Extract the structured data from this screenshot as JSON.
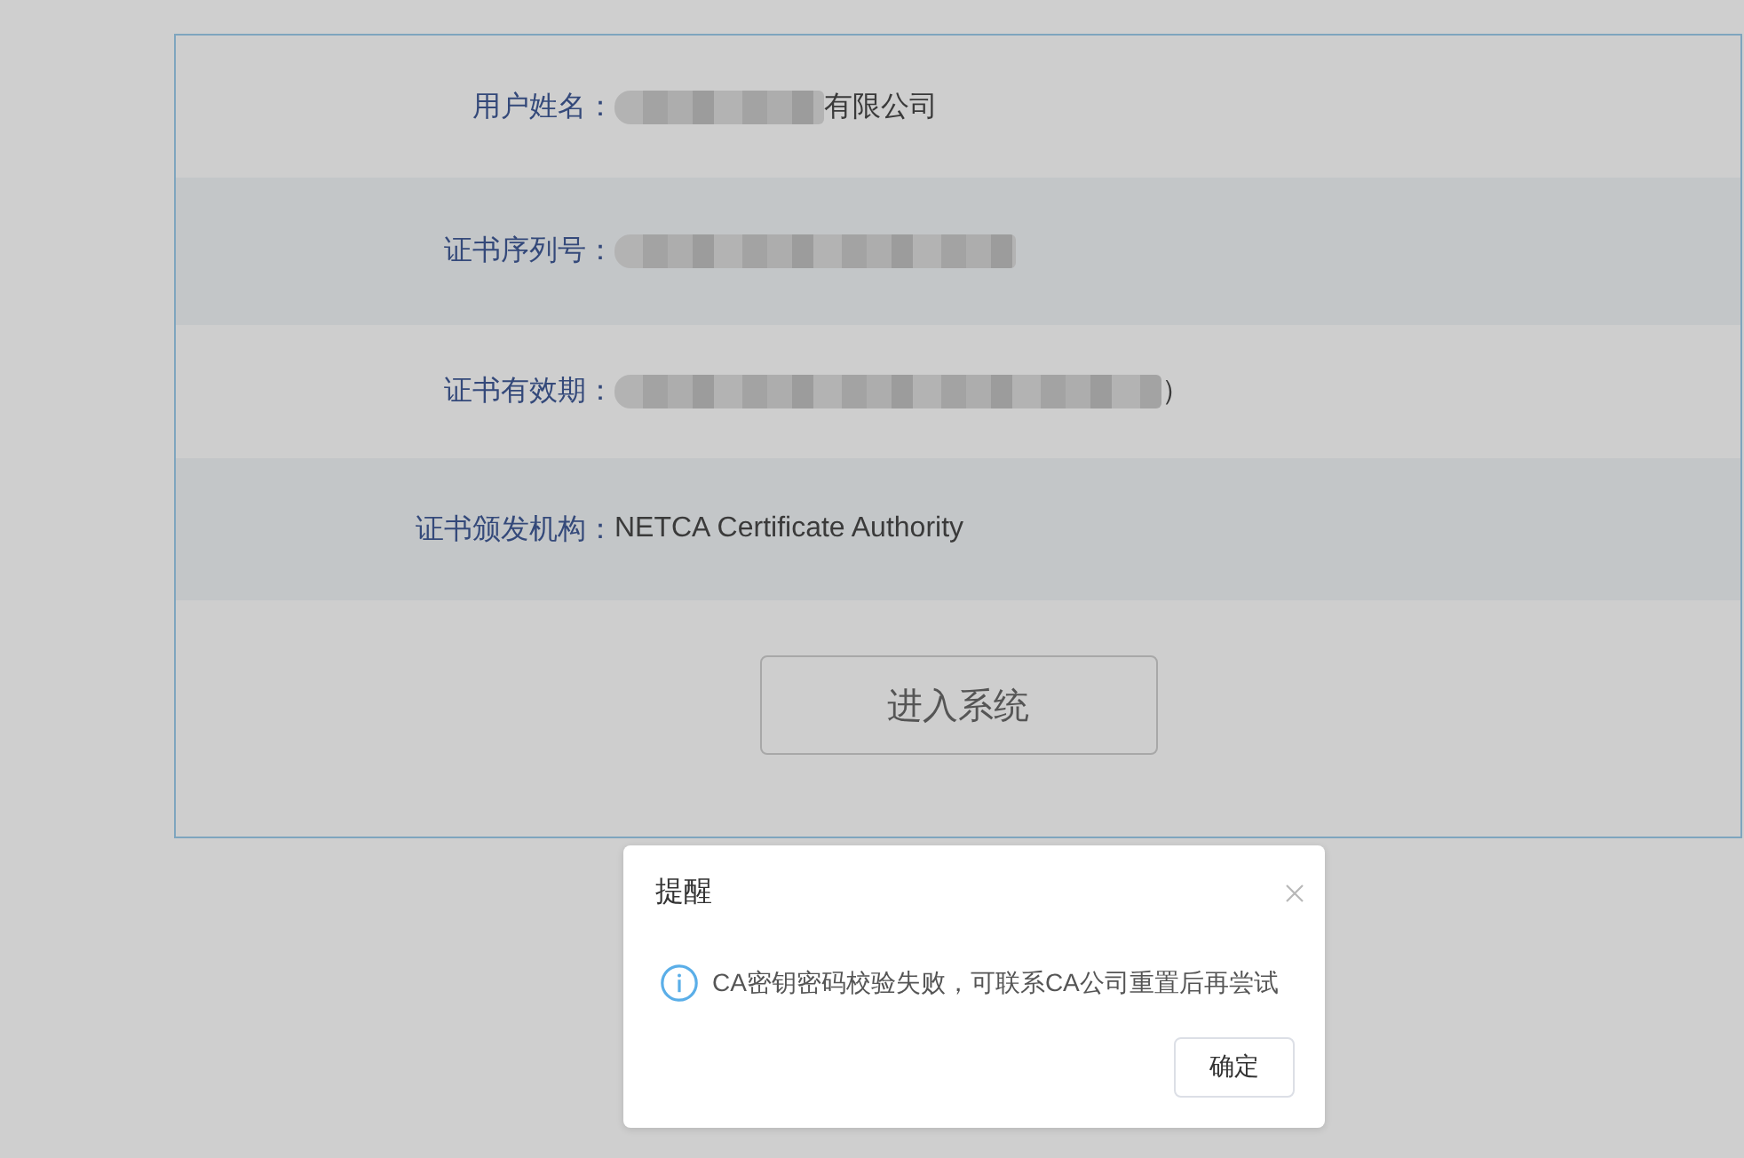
{
  "card": {
    "rows": [
      {
        "label": "用户姓名：",
        "redacted": true,
        "value": "有限公司"
      },
      {
        "label": "证书序列号：",
        "redacted": true
      },
      {
        "label": "证书有效期：",
        "redacted": true,
        "value": "）"
      },
      {
        "label": "证书颁发机构：",
        "redacted": false,
        "value": "NETCA Certificate Authority"
      }
    ],
    "enter_button": "进入系统"
  },
  "dialog": {
    "title": "提醒",
    "message": "CA密钥密码校验失败，可联系CA公司重置后再尝试",
    "confirm_button": "确定"
  }
}
